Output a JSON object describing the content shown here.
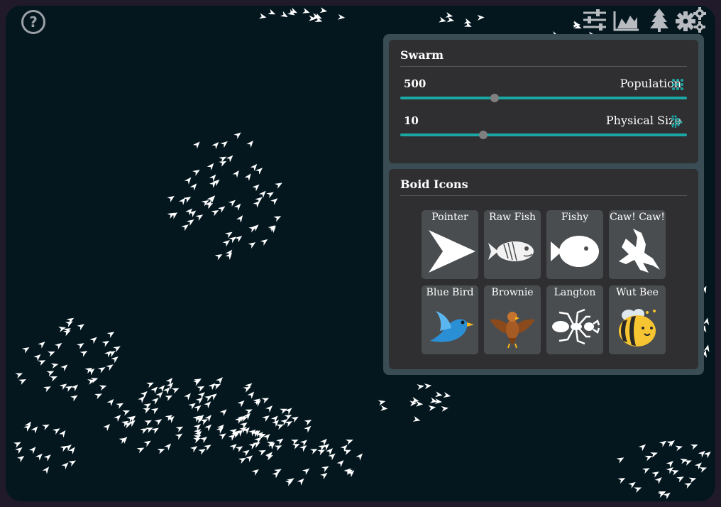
{
  "toolbar": {
    "icons": [
      "sliders-icon",
      "landscape-chart-icon",
      "tree-icon",
      "gears-icon"
    ]
  },
  "help": {
    "glyph": "?"
  },
  "swarm": {
    "title": "Swarm",
    "population": {
      "value": "500",
      "label": "Population",
      "fraction": 0.33
    },
    "physical_size": {
      "value": "10",
      "label": "Physical Size",
      "fraction": 0.29
    }
  },
  "boid_icons": {
    "title": "Boid Icons",
    "tiles": [
      {
        "label": "Pointer",
        "icon": "pointer-icon"
      },
      {
        "label": "Raw Fish",
        "icon": "raw-fish-icon"
      },
      {
        "label": "Fishy",
        "icon": "fishy-icon"
      },
      {
        "label": "Caw! Caw!",
        "icon": "crow-icon"
      },
      {
        "label": "Blue Bird",
        "icon": "blue-bird-icon"
      },
      {
        "label": "Brownie",
        "icon": "eagle-icon"
      },
      {
        "label": "Langton",
        "icon": "ant-icon"
      },
      {
        "label": "Wut Bee",
        "icon": "bee-icon"
      }
    ]
  },
  "colors": {
    "background": "#04171f",
    "panel": "#3a4d54",
    "card": "#2f2f31",
    "accent": "#1ba7a4",
    "boid": "#ffffff"
  }
}
